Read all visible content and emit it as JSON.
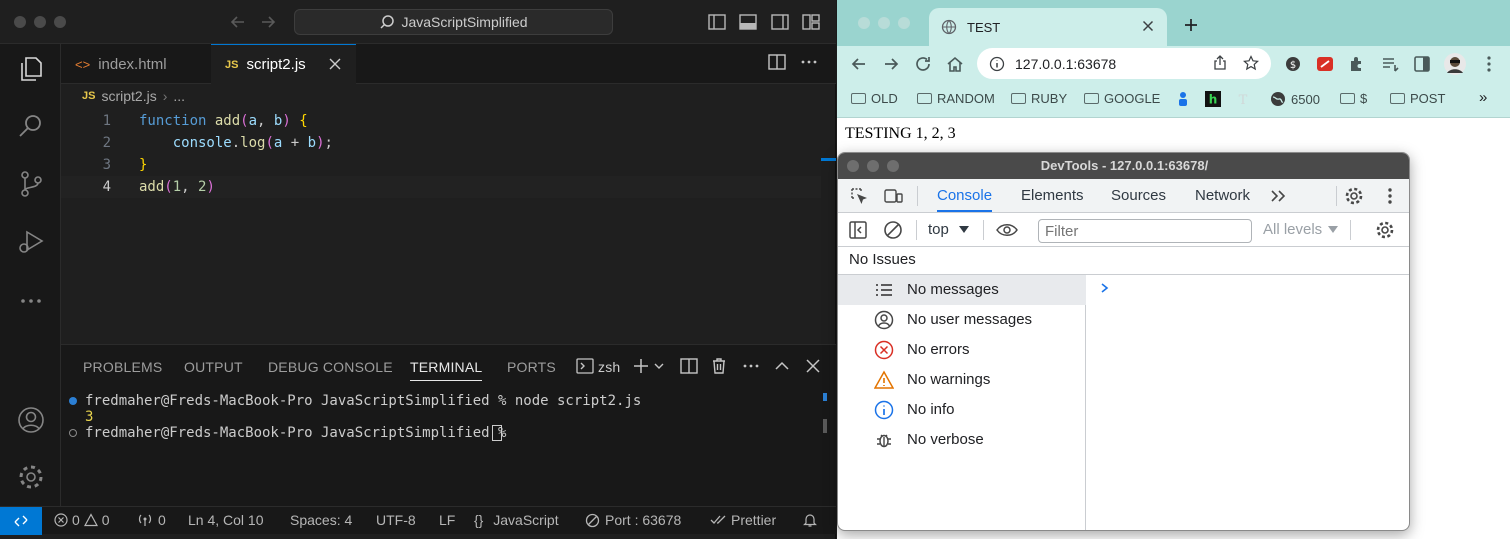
{
  "vscode": {
    "command_center": "JavaScriptSimplified",
    "tabs": [
      {
        "label": "index.html",
        "badge": "<>"
      },
      {
        "label": "script2.js",
        "badge": "JS"
      }
    ],
    "breadcrumb": {
      "badge": "JS",
      "file": "script2.js",
      "more": "..."
    },
    "line_numbers": [
      "1",
      "2",
      "3",
      "4"
    ],
    "code_lines": [
      "function add(a, b) {",
      "    console.log(a + b);",
      "}",
      "add(1, 2)"
    ],
    "panel": {
      "tabs": [
        "PROBLEMS",
        "OUTPUT",
        "DEBUG CONSOLE",
        "TERMINAL",
        "PORTS"
      ],
      "active_tab": "TERMINAL",
      "shell": "zsh"
    },
    "terminal": {
      "line1": "fredmaher@Freds-MacBook-Pro JavaScriptSimplified % node script2.js",
      "output": "3",
      "line2": "fredmaher@Freds-MacBook-Pro JavaScriptSimplified % "
    },
    "statusbar": {
      "errors": "0",
      "warnings": "0",
      "ports": "0",
      "position": "Ln 4, Col 10",
      "spaces": "Spaces: 4",
      "encoding": "UTF-8",
      "eol": "LF",
      "language_brackets": "{}",
      "language": "JavaScript",
      "port": "Port : 63678",
      "prettier": "Prettier"
    }
  },
  "chrome": {
    "tab_title": "TEST",
    "url": "127.0.0.1:63678",
    "bookmarks": [
      "OLD",
      "RANDOM",
      "RUBY",
      "GOOGLE",
      "6500",
      "$",
      "POST"
    ],
    "page_text": "TESTING 1, 2, 3"
  },
  "devtools": {
    "title": "DevTools - 127.0.0.1:63678/",
    "tabs": [
      "Console",
      "Elements",
      "Sources",
      "Network"
    ],
    "context": "top",
    "filter_placeholder": "Filter",
    "levels": "All levels",
    "issues": "No Issues",
    "sidebar": [
      {
        "label": "No messages",
        "icon": "list-icon"
      },
      {
        "label": "No user messages",
        "icon": "user-icon"
      },
      {
        "label": "No errors",
        "icon": "error-icon"
      },
      {
        "label": "No warnings",
        "icon": "warning-icon"
      },
      {
        "label": "No info",
        "icon": "info-icon"
      },
      {
        "label": "No verbose",
        "icon": "bug-icon"
      }
    ]
  },
  "colors": {
    "vscode_accent": "#0078d4",
    "chrome_frame": "#9ad4cf",
    "devtools_accent": "#1a73e8"
  }
}
